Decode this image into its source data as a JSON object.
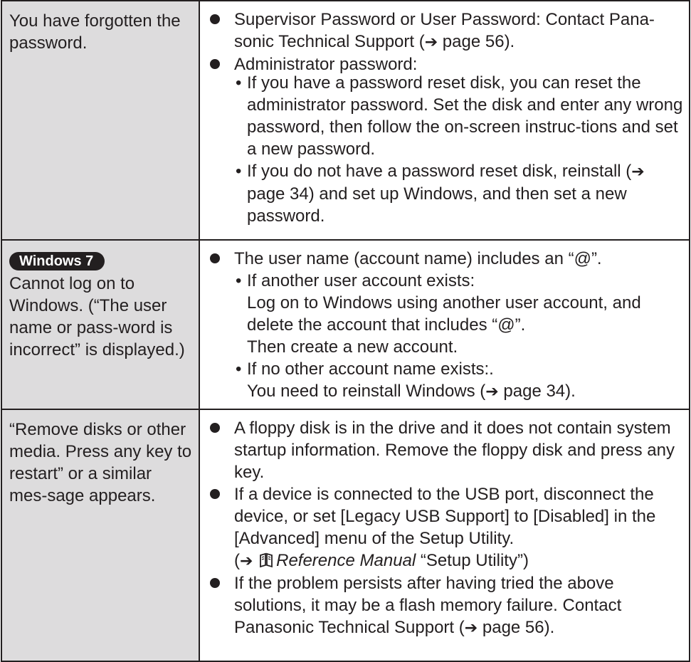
{
  "rows": [
    {
      "problem": "You have forgotten the password.",
      "solutions": [
        {
          "text": "Supervisor Password or User Password: Contact Pana-sonic Technical Support (",
          "ref": " page 56)."
        },
        {
          "text": "Administrator password:",
          "subs": [
            {
              "dot": "•",
              "text": "If you have a password reset disk, you can reset the administrator password. Set the disk and enter any wrong password, then follow the on-screen instruc-tions and set a new password."
            },
            {
              "dot": "•",
              "text": "If you do not have a password reset disk, reinstall (",
              "ref": " page 34) and set up Windows, and then set a new password."
            }
          ]
        }
      ]
    },
    {
      "badge": "Windows 7",
      "problem": "Cannot log on to Windows. (“The user name or pass-word is incorrect” is displayed.)",
      "solutions": [
        {
          "text": "The user name (account name) includes an “@”.",
          "subs": [
            {
              "dot": "•",
              "text": "If another user account exists:",
              "lines": [
                "Log on to Windows using another user account, and delete the account that includes “@”.",
                "Then create a new account."
              ]
            },
            {
              "dot": "•",
              "text": "If no other account name exists:.",
              "lines": [
                "You need to reinstall Windows ("
              ],
              "ref": " page 34)."
            }
          ]
        }
      ]
    },
    {
      "problem": "“Remove disks or other media. Press any key to restart” or a similar mes-sage appears.",
      "solutions": [
        {
          "text": "A floppy disk is in the drive and it does not contain system startup information. Remove the floppy disk and press any key."
        },
        {
          "text": "If a device is connected to the USB port, disconnect the device, or set [Legacy USB Support] to [Disabled] in the [Advanced] menu of the Setup Utility.",
          "ref_open": "(",
          "ref_manual": "Reference Manual",
          "ref_close": " “Setup Utility”)"
        },
        {
          "text": "If the problem persists after having tried the above solutions, it may be a flash memory failure. Contact Panasonic Technical Support (",
          "ref": " page 56)."
        }
      ]
    }
  ],
  "icons": {
    "arrow": "➔",
    "bullet": "●",
    "book": "reference-manual-book-icon"
  }
}
